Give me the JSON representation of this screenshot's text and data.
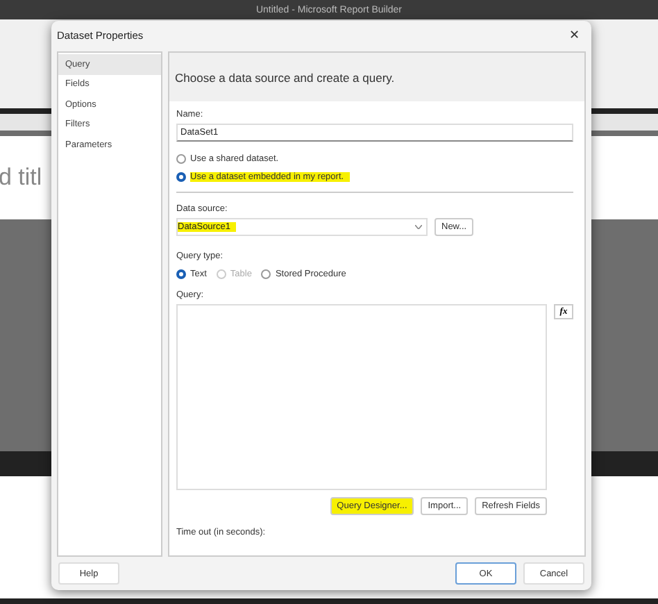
{
  "app": {
    "title": "Untitled - Microsoft Report Builder",
    "canvas_text": "d titl"
  },
  "dialog": {
    "title": "Dataset Properties",
    "close": "✕",
    "sidebar": [
      {
        "label": "Query",
        "selected": true
      },
      {
        "label": "Fields",
        "selected": false
      },
      {
        "label": "Options",
        "selected": false
      },
      {
        "label": "Filters",
        "selected": false
      },
      {
        "label": "Parameters",
        "selected": false
      }
    ],
    "heading": "Choose a data source and create a query.",
    "name_label": "Name:",
    "name_value": "DataSet1",
    "dataset_options": [
      {
        "label": "Use a shared dataset.",
        "selected": false,
        "highlighted": false
      },
      {
        "label": "Use a dataset embedded in my report.",
        "selected": true,
        "highlighted": true
      }
    ],
    "data_source_label": "Data source:",
    "data_source": {
      "value": "DataSource1",
      "highlighted": true
    },
    "new_button": "New...",
    "query_type_label": "Query type:",
    "query_types": [
      {
        "label": "Text",
        "selected": true,
        "disabled": false
      },
      {
        "label": "Table",
        "selected": false,
        "disabled": true
      },
      {
        "label": "Stored Procedure",
        "selected": false,
        "disabled": false
      }
    ],
    "query_label": "Query:",
    "fx_button": "fx",
    "query_buttons": [
      {
        "label": "Query Designer...",
        "highlighted": true
      },
      {
        "label": "Import...",
        "highlighted": false
      },
      {
        "label": "Refresh Fields",
        "highlighted": false
      }
    ],
    "timeout_label": "Time out (in seconds):",
    "footer_left": "Help",
    "footer_right": [
      {
        "label": "OK",
        "default": true
      },
      {
        "label": "Cancel",
        "default": false
      }
    ]
  }
}
